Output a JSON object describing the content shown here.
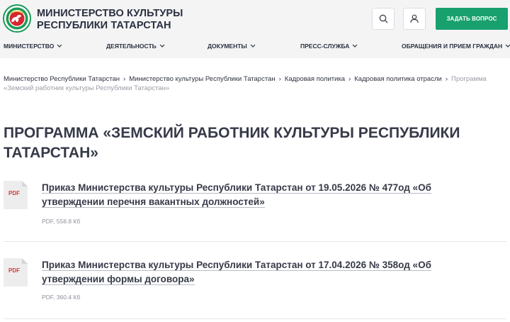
{
  "header": {
    "brand_line1": "МИНИСТЕРСТВО КУЛЬТУРЫ",
    "brand_line2": "РЕСПУБЛИКИ ТАТАРСТАН",
    "ask_button": "ЗАДАТЬ ВОПРОС",
    "logo_icon": "tatarstan-emblem-icon",
    "search_icon": "search-icon",
    "user_icon": "user-icon",
    "accent_color": "#18a06e"
  },
  "nav": {
    "items": [
      {
        "label": "МИНИСТЕРСТВО"
      },
      {
        "label": "ДЕЯТЕЛЬНОСТЬ"
      },
      {
        "label": "ДОКУМЕНТЫ"
      },
      {
        "label": "ПРЕСС-СЛУЖБА"
      },
      {
        "label": "ОБРАЩЕНИЯ И ПРИЕМ ГРАЖДАН"
      }
    ]
  },
  "breadcrumb": {
    "items": [
      "Министерство Республики Татарстан",
      "Министерство культуры Республики Татарстан",
      "Кадровая политика",
      "Кадровая политика отрасли"
    ],
    "current": "Программа «Земский работник культуры Республики Татарстан»"
  },
  "page": {
    "title": "ПРОГРАММА «ЗЕМСКИЙ РАБОТНИК КУЛЬТУРЫ РЕСПУБЛИКИ ТАТАРСТАН»"
  },
  "documents": [
    {
      "type_label": "PDF",
      "title": "Приказ Министерства культуры Республики Татарстан от 19.05.2026 № 477од «Об утверждении перечня вакантных должностей»",
      "meta": "PDF, 558.8 Кб"
    },
    {
      "type_label": "PDF",
      "title": "Приказ Министерства культуры Республики Татарстан от 17.04.2026 № 358од «Об утверждении формы договора»",
      "meta": "PDF, 360.4 Кб"
    }
  ]
}
